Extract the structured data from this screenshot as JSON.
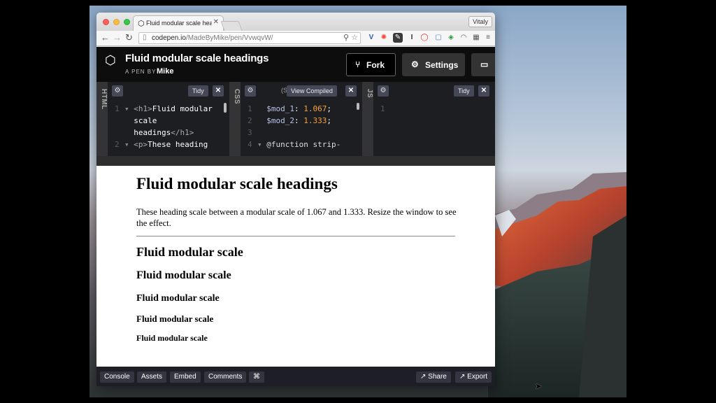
{
  "browser": {
    "tab_title": "Fluid modular scale headi",
    "profile_name": "Vitaly",
    "url_host": "codepen.io",
    "url_path": "/MadeByMike/pen/VvwqvW/"
  },
  "codepen": {
    "pen_title": "Fluid modular scale headings",
    "by_label": "A PEN BY",
    "author": "Mike",
    "fork_label": "Fork",
    "settings_label": "Settings"
  },
  "editors": {
    "html": {
      "label": "HTML",
      "tidy_label": "Tidy",
      "lines": [
        {
          "n": "1",
          "open": "<h1>",
          "text": "Fluid modular"
        },
        {
          "n": "",
          "text": "scale"
        },
        {
          "n": "",
          "text": "headings",
          "close": "</h1>"
        },
        {
          "n": "2",
          "open": "<p>",
          "text": "These heading"
        }
      ]
    },
    "css": {
      "label": "CSS",
      "preprocessor_label": "(S",
      "view_compiled_label": "View Compiled",
      "lines": [
        {
          "n": "1",
          "var": "$mod_1",
          "val": "1.067"
        },
        {
          "n": "2",
          "var": "$mod_2",
          "val": "1.333"
        },
        {
          "n": "3"
        },
        {
          "n": "4",
          "at": "@function strip-"
        }
      ]
    },
    "js": {
      "label": "JS",
      "tidy_label": "Tidy",
      "line_1": "1"
    }
  },
  "result": {
    "h1": "Fluid modular scale headings",
    "paragraph": "These heading scale between a modular scale of 1.067 and 1.333. Resize the window to see the effect.",
    "h2": "Fluid modular scale",
    "h3": "Fluid modular scale",
    "h4": "Fluid modular scale",
    "h5": "Fluid modular scale",
    "h6": "Fluid modular scale"
  },
  "footer": {
    "console": "Console",
    "assets": "Assets",
    "embed": "Embed",
    "comments": "Comments",
    "shortcuts": "⌘",
    "share": "Share",
    "export": "Export"
  },
  "colors": {
    "codepen_header": "#0d0d0d",
    "editor_bg": "#1d1e22",
    "code_number": "#f9a33a",
    "footer_bg": "#1e1f26"
  }
}
